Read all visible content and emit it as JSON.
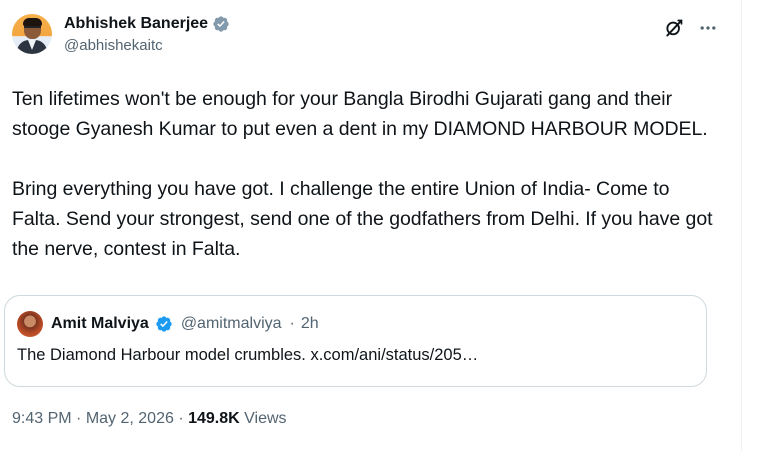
{
  "author": {
    "display_name": "Abhishek Banerjee",
    "handle": "@abhishekaitc",
    "verified_color": "#829aab"
  },
  "tweet": {
    "text": "Ten lifetimes won't be enough for your Bangla Birodhi Gujarati gang and their stooge Gyanesh Kumar to put even a dent in my DIAMOND HARBOUR MODEL.\n\nBring everything you have got. I challenge the entire Union of India- Come to Falta. Send your strongest, send one of the godfathers from Delhi. If you have got the nerve, contest in Falta."
  },
  "quoted_tweet": {
    "display_name": "Amit Malviya",
    "handle": "@amitmalviya",
    "separator": "·",
    "time": "2h",
    "text": "The Diamond Harbour model crumbles. x.com/ani/status/205…",
    "verified_color": "#1d9bf0"
  },
  "footer": {
    "time": "9:43 PM",
    "dot1": " · ",
    "date": "May 2, 2026",
    "dot2": " · ",
    "views_count": "149.8K",
    "views_label": " Views"
  },
  "icons": {
    "grok": "grok-icon",
    "more": "more-options-icon",
    "verified": "verified-badge-icon"
  }
}
